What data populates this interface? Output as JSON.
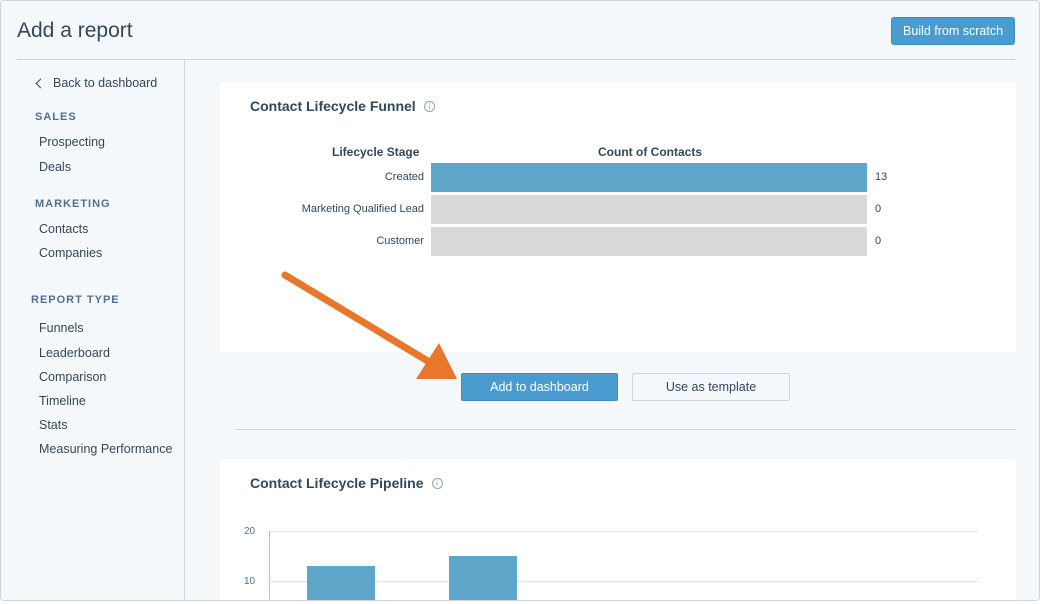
{
  "header": {
    "title": "Add a report",
    "build_button": "Build from scratch"
  },
  "sidebar": {
    "back_label": "Back to dashboard",
    "sections": [
      {
        "heading": "SALES",
        "items": [
          "Prospecting",
          "Deals"
        ]
      },
      {
        "heading": "MARKETING",
        "items": [
          "Contacts",
          "Companies"
        ]
      },
      {
        "heading": "REPORT TYPE",
        "items": [
          "Funnels",
          "Leaderboard",
          "Comparison",
          "Timeline",
          "Stats",
          "Measuring Performance"
        ]
      }
    ]
  },
  "funnel_card": {
    "title": "Contact Lifecycle Funnel",
    "col_stage": "Lifecycle Stage",
    "col_count": "Count of Contacts",
    "rows": [
      {
        "stage": "Created",
        "count": "13",
        "value": 13
      },
      {
        "stage": "Marketing Qualified Lead",
        "count": "0",
        "value": 0
      },
      {
        "stage": "Customer",
        "count": "0",
        "value": 0
      }
    ],
    "max_value": 13
  },
  "actions": {
    "add_label": "Add to dashboard",
    "template_label": "Use as template"
  },
  "pipeline_card": {
    "title": "Contact Lifecycle Pipeline"
  },
  "chart_data": {
    "type": "bar",
    "title": "Contact Lifecycle Pipeline",
    "categories": [
      "",
      ""
    ],
    "values": [
      13,
      15
    ],
    "yticks": [
      "20",
      "10"
    ],
    "ylim": [
      0,
      20
    ],
    "grid": true
  },
  "colors": {
    "accent": "#4a9bd0",
    "bar": "#5ea6ca",
    "empty_bar": "#d9d9d9",
    "arrow": "#e8762b"
  },
  "icons": {
    "back": "chevron-left-icon",
    "info": "info-icon",
    "pointer": "arrow-annotation-icon"
  }
}
